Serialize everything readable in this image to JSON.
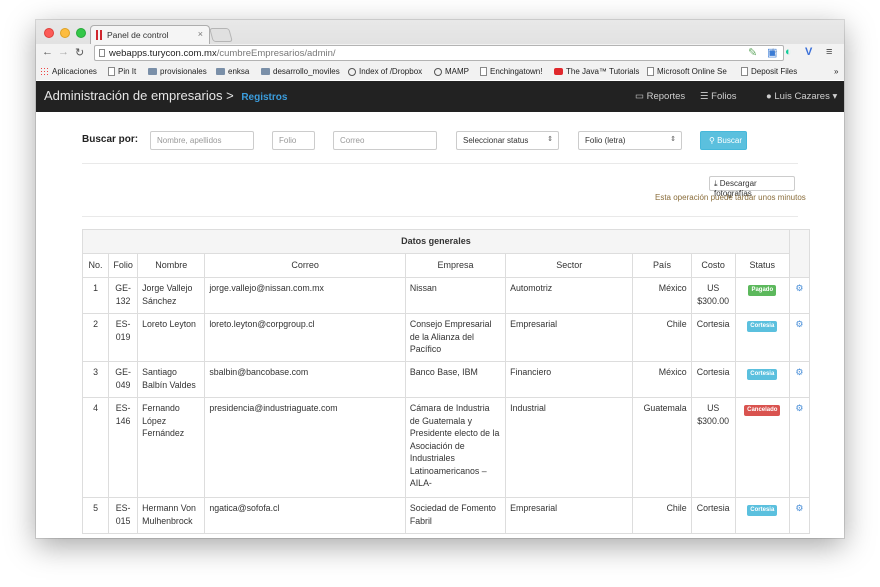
{
  "browser": {
    "tab_title": "Panel de control",
    "tab_close": "×",
    "url_host": "webapps.turycon.com.mx",
    "url_path": "/cumbreEmpresarios/admin/",
    "bookmarks": [
      {
        "label": "Aplicaciones",
        "icon": "apps-grid-icon"
      },
      {
        "label": "Pin It",
        "icon": "page-icon"
      },
      {
        "label": "provisionales",
        "icon": "folder-icon"
      },
      {
        "label": "enksa",
        "icon": "folder-icon"
      },
      {
        "label": "desarrollo_moviles",
        "icon": "folder-icon"
      },
      {
        "label": "Index of /Dropbox",
        "icon": "globe-icon"
      },
      {
        "label": "MAMP",
        "icon": "globe-icon"
      },
      {
        "label": "Enchingatown!",
        "icon": "page-icon"
      },
      {
        "label": "The Java™ Tutorials",
        "icon": "red-icon"
      },
      {
        "label": "Microsoft Online Se",
        "icon": "page-icon"
      },
      {
        "label": "Deposit Files",
        "icon": "page-icon"
      }
    ],
    "bookmarks_more": "»"
  },
  "navbar": {
    "brand": "Administración de empresarios",
    "breadcrumb_sep": ">",
    "section": "Registros",
    "reportes": "Reportes",
    "folios": "Folios",
    "user": "Luis Cazares"
  },
  "filters": {
    "label": "Buscar por:",
    "nombre_placeholder": "Nombre, apellidos",
    "folio_placeholder": "Folio",
    "correo_placeholder": "Correo",
    "status_select": "Seleccionar status",
    "folio_letra_select": "Folio (letra)",
    "search_button": "Buscar"
  },
  "download": {
    "button": "Descargar fotografías",
    "note": "Esta operación puede tardar unos minutos"
  },
  "table": {
    "group_header": "Datos generales",
    "columns": [
      "No.",
      "Folio",
      "Nombre",
      "Correo",
      "Empresa",
      "Sector",
      "País",
      "Costo",
      "Status"
    ],
    "rows": [
      {
        "no": "1",
        "folio": "GE-132",
        "nombre": "Jorge Vallejo Sánchez",
        "correo": "jorge.vallejo@nissan.com.mx",
        "empresa": "Nissan",
        "sector": "Automotriz",
        "pais": "México",
        "costo": "US $300.00",
        "status": "Pagado",
        "status_color": "#5cb85c"
      },
      {
        "no": "2",
        "folio": "ES-019",
        "nombre": "Loreto Leyton",
        "correo": "loreto.leyton@corpgroup.cl",
        "empresa": "Consejo Empresarial de la Alianza del Pacífico",
        "sector": "Empresarial",
        "pais": "Chile",
        "costo": "Cortesia",
        "status": "Cortesia",
        "status_color": "#5bc0de"
      },
      {
        "no": "3",
        "folio": "GE-049",
        "nombre": "Santiago Balbín Valdes",
        "correo": "sbalbin@bancobase.com",
        "empresa": "Banco Base, IBM",
        "sector": "Financiero",
        "pais": "México",
        "costo": "Cortesia",
        "status": "Cortesia",
        "status_color": "#5bc0de"
      },
      {
        "no": "4",
        "folio": "ES-146",
        "nombre": "Fernando López Fernández",
        "correo": "presidencia@industriaguate.com",
        "empresa": "Cámara de Industria de Guatemala y Presidente electo de la Asociación de Industriales Latinoamericanos – AILA-",
        "sector": "Industrial",
        "pais": "Guatemala",
        "costo": "US $300.00",
        "status": "Cancelado",
        "status_color": "#d9534f"
      },
      {
        "no": "5",
        "folio": "ES-015",
        "nombre": "Hermann Von Mulhenbrock",
        "correo": "ngatica@sofofa.cl",
        "empresa": "Sociedad de Fomento Fabril",
        "sector": "Empresarial",
        "pais": "Chile",
        "costo": "Cortesia",
        "status": "Cortesia",
        "status_color": "#5bc0de"
      }
    ]
  }
}
